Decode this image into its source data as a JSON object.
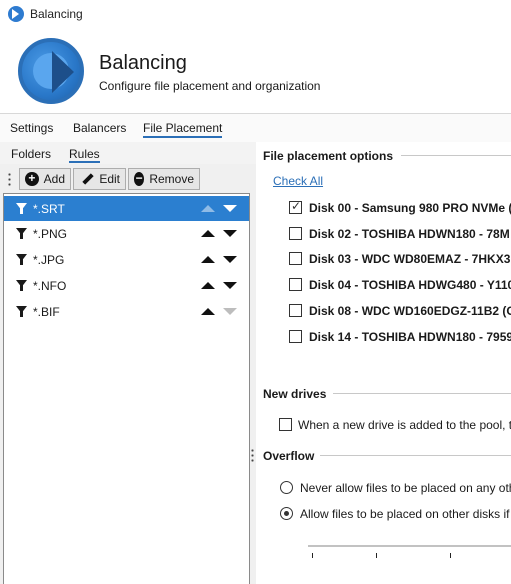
{
  "window": {
    "title": "Balancing"
  },
  "header": {
    "title": "Balancing",
    "subtitle": "Configure file placement and organization"
  },
  "tabs": [
    {
      "label": "Settings"
    },
    {
      "label": "Balancers"
    },
    {
      "label": "File Placement",
      "active": true
    }
  ],
  "subtabs": [
    {
      "label": "Folders"
    },
    {
      "label": "Rules",
      "active": true
    }
  ],
  "toolbar": {
    "add_label": "Add",
    "edit_label": "Edit",
    "remove_label": "Remove"
  },
  "rules": [
    {
      "name": "*.SRT",
      "selected": true,
      "up_enabled": false,
      "down_enabled": true
    },
    {
      "name": "*.PNG",
      "selected": false,
      "up_enabled": true,
      "down_enabled": true
    },
    {
      "name": "*.JPG",
      "selected": false,
      "up_enabled": true,
      "down_enabled": true
    },
    {
      "name": "*.NFO",
      "selected": false,
      "up_enabled": true,
      "down_enabled": true
    },
    {
      "name": "*.BIF",
      "selected": false,
      "up_enabled": true,
      "down_enabled": false
    }
  ],
  "placement": {
    "section_title": "File placement options",
    "check_all_label": "Check All",
    "disks": [
      {
        "label": "Disk 00 - Samsung 980 PRO NVMe (",
        "checked": true
      },
      {
        "label": "Disk 02 - TOSHIBA HDWN180 - 78M",
        "checked": false
      },
      {
        "label": "Disk 03 - WDC WD80EMAZ - 7HKX3",
        "checked": false
      },
      {
        "label": "Disk 04 - TOSHIBA HDWG480 - Y110",
        "checked": false
      },
      {
        "label": "Disk 08 - WDC WD160EDGZ-11B2 (C",
        "checked": false
      },
      {
        "label": "Disk 14 - TOSHIBA HDWN180 - 7959",
        "checked": false
      }
    ]
  },
  "new_drives": {
    "section_title": "New drives",
    "option_label": "When a new drive is added to the pool, t",
    "checked": false
  },
  "overflow": {
    "section_title": "Overflow",
    "options": [
      {
        "label": "Never allow files to be placed on any oth",
        "selected": false
      },
      {
        "label": "Allow files to be placed on other disks if",
        "selected": true
      }
    ]
  },
  "colors": {
    "accent": "#2b7fd0",
    "link": "#2b6fb7",
    "selected_row": "#2b7fd0"
  }
}
